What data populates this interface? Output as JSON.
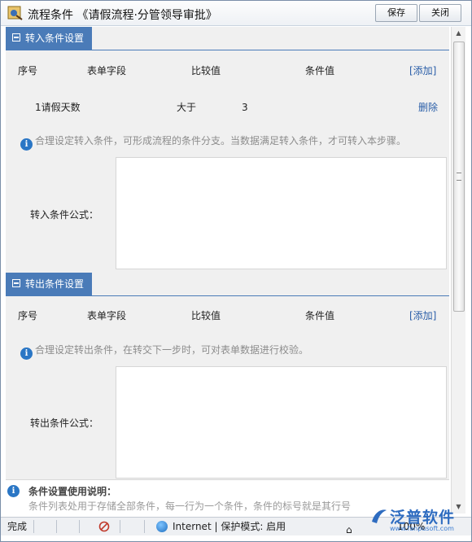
{
  "window": {
    "title": "流程条件 《请假流程·分管领导审批》",
    "save_label": "保存",
    "close_label": "关闭"
  },
  "in_section": {
    "heading": "转入条件设置",
    "columns": [
      "序号",
      "表单字段",
      "比较值",
      "条件值"
    ],
    "add_label": "[添加]",
    "rows": [
      {
        "field": "1请假天数",
        "compare": "大于",
        "value": "3",
        "action": "删除"
      }
    ],
    "hint": "合理设定转入条件，可形成流程的条件分支。当数据满足转入条件，才可转入本步骤。",
    "formula_label": "转入条件公式："
  },
  "out_section": {
    "heading": "转出条件设置",
    "columns": [
      "序号",
      "表单字段",
      "比较值",
      "条件值"
    ],
    "add_label": "[添加]",
    "hint": "合理设定转出条件，在转交下一步时，可对表单数据进行校验。",
    "formula_label": "转出条件公式："
  },
  "usage": {
    "title": "条件设置使用说明：",
    "text": "条件列表处用于存储全部条件，每一行为一个条件，条件的标号就是其行号"
  },
  "status": {
    "done": "完成",
    "zone": "Internet | 保护模式: 启用",
    "zoom": "100%"
  },
  "watermark": {
    "brand": "泛普软件",
    "url": "www.fanpusoft.com"
  },
  "colors": {
    "section_header": "#4a7bb8",
    "link": "#2a5ea8",
    "hint": "#8c8c8c",
    "info_icon": "#2a76c5"
  }
}
